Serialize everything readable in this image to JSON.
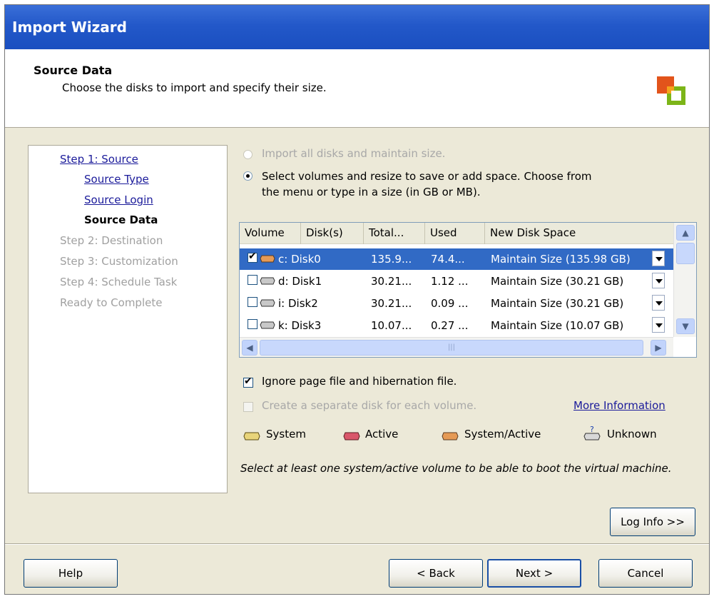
{
  "window": {
    "title": "Import Wizard"
  },
  "header": {
    "title": "Source Data",
    "subtitle": "Choose the disks to import and specify their size.",
    "logo_icon": "vmware-logo-icon"
  },
  "steps": [
    {
      "label": "Step 1: Source",
      "state": "link"
    },
    {
      "label": "Source Type",
      "state": "link"
    },
    {
      "label": "Source Login",
      "state": "link"
    },
    {
      "label": "Source Data",
      "state": "current"
    },
    {
      "label": "Step 2: Destination",
      "state": "disabled"
    },
    {
      "label": "Step 3: Customization",
      "state": "disabled"
    },
    {
      "label": "Step 4: Schedule Task",
      "state": "disabled"
    },
    {
      "label": "Ready to Complete",
      "state": "disabled"
    }
  ],
  "options": {
    "import_all": {
      "label": "Import all disks and maintain size.",
      "selected": false,
      "enabled": false
    },
    "select_volumes": {
      "line1": "Select volumes and resize to save or add space. Choose from",
      "line2": "the menu or type in a size (in GB or MB).",
      "selected": true
    }
  },
  "volumes": {
    "columns": [
      "Volume",
      "Disk(s)",
      "Total...",
      "Used",
      "New Disk Space"
    ],
    "rows": [
      {
        "checked": true,
        "selected": true,
        "volume_disk": "c: Disk0",
        "total": "135.9...",
        "used": "74.4...",
        "new_space": "Maintain Size (135.98 GB)"
      },
      {
        "checked": false,
        "selected": false,
        "volume_disk": "d: Disk1",
        "total": "30.21...",
        "used": "1.12 ...",
        "new_space": "Maintain Size (30.21 GB)"
      },
      {
        "checked": false,
        "selected": false,
        "volume_disk": "i:  Disk2",
        "total": "30.21...",
        "used": "0.09 ...",
        "new_space": "Maintain Size (30.21 GB)"
      },
      {
        "checked": false,
        "selected": false,
        "volume_disk": "k: Disk3",
        "total": "10.07...",
        "used": "0.27 ...",
        "new_space": "Maintain Size (10.07 GB)"
      }
    ]
  },
  "checkboxes": {
    "ignore_pagefile": {
      "label": "Ignore page file and hibernation file.",
      "checked": true
    },
    "separate_disk": {
      "label": "Create a separate disk for each volume.",
      "checked": false,
      "enabled": false
    }
  },
  "more_info_link": "More Information",
  "legend": {
    "system": "System",
    "active": "Active",
    "system_active": "System/Active",
    "unknown": "Unknown"
  },
  "note": "Select at least one system/active volume to be able to boot the virtual machine.",
  "buttons": {
    "log_info": "Log Info >>",
    "help": "Help",
    "back": "< Back",
    "next": "Next >",
    "cancel": "Cancel"
  },
  "colors": {
    "title_bar": "#2358c9",
    "selection": "#316ac5",
    "link": "#1a1a9a",
    "disk_system": "#e8d47a",
    "disk_active": "#d9576a",
    "disk_system_active": "#e59a55"
  }
}
